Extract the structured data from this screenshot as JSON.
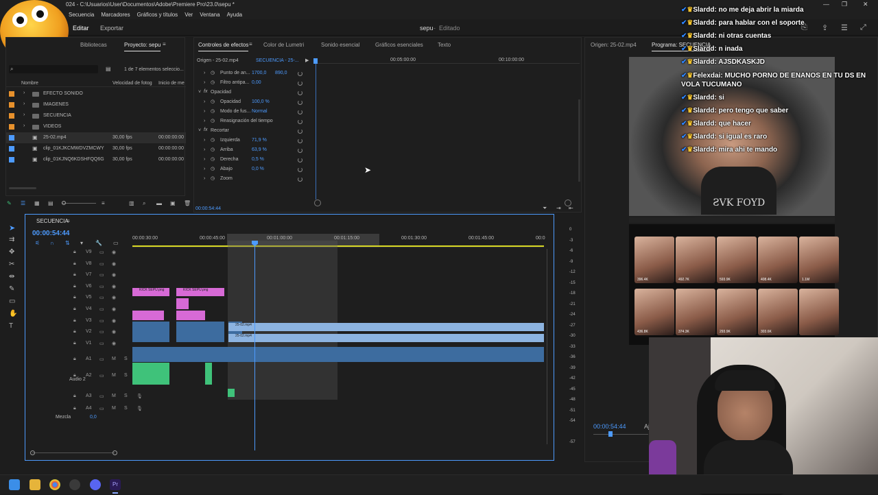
{
  "window": {
    "title": "024 - C:\\Usuarios\\User\\Documentos\\Adobe\\Premiere Pro\\23.0\\sepu *",
    "menu": [
      "Secuencia",
      "Marcadores",
      "Gráficos y títulos",
      "Ver",
      "Ventana",
      "Ayuda"
    ]
  },
  "workspace": {
    "tabs": [
      "Editar",
      "Exportar"
    ],
    "project_title": "sepu",
    "status": "Editado"
  },
  "project_panel": {
    "tabs": [
      "Bibliotecas",
      "Proyecto: sepu"
    ],
    "count": "1 de 7 elementos seleccio...",
    "columns": [
      "Nombre",
      "Velocidad de fotog",
      "Inicio de me"
    ],
    "items": [
      {
        "name": "EFECTO SONIDO",
        "fps": "",
        "start": "",
        "type": "folder",
        "color": "#e8912c"
      },
      {
        "name": "IMAGENES",
        "fps": "",
        "start": "",
        "type": "folder",
        "color": "#e8912c"
      },
      {
        "name": "SECUENCIA",
        "fps": "",
        "start": "",
        "type": "folder",
        "color": "#e8912c"
      },
      {
        "name": "VIDEOS",
        "fps": "",
        "start": "",
        "type": "folder",
        "color": "#e8912c"
      },
      {
        "name": "25-02.mp4",
        "fps": "30,00 fps",
        "start": "00:00:00:00",
        "type": "clip",
        "color": "#4d9bff"
      },
      {
        "name": "clip_01KJKCMWDVZMCWY",
        "fps": "30,00 fps",
        "start": "00:00:00:00",
        "type": "clip",
        "color": "#4d9bff"
      },
      {
        "name": "clip_01KJNQ6KDSHFQQ6G",
        "fps": "30,00 fps",
        "start": "00:00:00:00",
        "type": "clip",
        "color": "#4d9bff"
      }
    ]
  },
  "effects_panel": {
    "tabs": [
      "Controles de efectos",
      "Color de Lumetri",
      "Sonido esencial",
      "Gráficos esenciales",
      "Texto"
    ],
    "source": "Origen - 25-02.mp4",
    "sequence": "SECUENCIA - 25-...",
    "ruler": [
      "00:05:00:00",
      "00:10:00:00"
    ],
    "props": [
      {
        "label": "Punto de an...",
        "value": "1700,0",
        "value2": "890,0"
      },
      {
        "label": "Filtro antipa...",
        "value": "0,00",
        "value2": ""
      },
      {
        "label": "Opacidad",
        "value": "",
        "value2": "",
        "fx": true
      },
      {
        "label": "Opacidad",
        "value": "100,0 %",
        "value2": ""
      },
      {
        "label": "Modo de fus...",
        "value": "Normal",
        "value2": ""
      },
      {
        "label": "Reasignación del tiempo",
        "value": "",
        "value2": ""
      },
      {
        "label": "Recortar",
        "value": "",
        "value2": "",
        "fx": true
      },
      {
        "label": "Izquierda",
        "value": "71,9 %",
        "value2": ""
      },
      {
        "label": "Arriba",
        "value": "63,9 %",
        "value2": ""
      },
      {
        "label": "Derecha",
        "value": "0,5 %",
        "value2": ""
      },
      {
        "label": "Abajo",
        "value": "0,0 %",
        "value2": ""
      },
      {
        "label": "Zoom",
        "value": "",
        "value2": ""
      }
    ],
    "timecode": "00:00:54:44"
  },
  "program_panel": {
    "tabs": [
      "Origen: 25-02.mp4",
      "Programa: SECUENCIA"
    ],
    "timecode": "00:00:54:44",
    "fit": "Aj"
  },
  "timeline": {
    "name": "SECUENCIA",
    "timecode": "00:00:54:44",
    "ruler": [
      "00:00:30:00",
      "00:00:45:00",
      "00:01:00:00",
      "00:01:15:00",
      "00:01:30:00",
      "00:01:45:00",
      "00:0"
    ],
    "video_tracks": [
      "V9",
      "V8",
      "V7",
      "V6",
      "V5",
      "V4",
      "V3",
      "V2",
      "V1"
    ],
    "audio_tracks": [
      "A1",
      "A2",
      "A3",
      "A4"
    ],
    "audio2_label": "Audio 2",
    "mix_label": "Mezcla",
    "mix_value": "0,0",
    "clip_labels": {
      "kick1": "KICK SEPU.png",
      "kick2": "KICK SEPU.png",
      "v2": "25-02.mp4",
      "v1": "25-02.mp4"
    },
    "db_scale": [
      "0",
      "-6",
      "-12",
      "-18",
      "-24",
      "-30",
      "-36",
      "-42",
      "-48",
      "-54",
      "-57"
    ],
    "db_scale_extra": [
      "-3",
      "-9",
      "-15",
      "-21",
      "-27",
      "-33",
      "-39",
      "-45",
      "-51"
    ]
  },
  "chat": [
    {
      "user": "Slardd",
      "msg": "no me deja abrir la miarda"
    },
    {
      "user": "Slardd",
      "msg": "para hablar con el soporte"
    },
    {
      "user": "Slardd",
      "msg": "ni otras cuentas"
    },
    {
      "user": "Slardd",
      "msg": "n inada"
    },
    {
      "user": "Slardd",
      "msg": "AJSDKASKJD"
    },
    {
      "user": "Felexdai",
      "msg": "MUCHO PORNO DE ENANOS EN TU DS EN VOLA TUCUMANO"
    },
    {
      "user": "Slardd",
      "msg": "si"
    },
    {
      "user": "Slardd",
      "msg": "pero tengo que saber"
    },
    {
      "user": "Slardd",
      "msg": "que hacer"
    },
    {
      "user": "Slardd",
      "msg": "si igual es raro"
    },
    {
      "user": "Slardd",
      "msg": "mira ahi te mando"
    }
  ],
  "thumbnails": [
    {
      "views": "396.4K"
    },
    {
      "views": "492.7K"
    },
    {
      "views": "593.9K"
    },
    {
      "views": "408.4K"
    },
    {
      "views": "1.1M"
    },
    {
      "views": "436.8K"
    },
    {
      "views": "374.3K"
    },
    {
      "views": "293.9K"
    },
    {
      "views": "303.6K"
    },
    {
      "views": ""
    }
  ],
  "colors": {
    "accent": "#4d9bff",
    "clip_pink": "#d76ad6",
    "clip_blue": "#8cb3e0",
    "audio_green": "#3fc27a",
    "playhead": "#4d9bff"
  }
}
